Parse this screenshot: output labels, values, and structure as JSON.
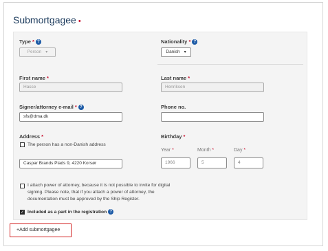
{
  "section": {
    "title": "Submortgagee",
    "required_marker": "•"
  },
  "type": {
    "label": "Type",
    "required": "*",
    "value": "Person"
  },
  "nationality": {
    "label": "Nationality",
    "required": "*",
    "value": "Danish"
  },
  "first_name": {
    "label": "First name",
    "required": "*",
    "value": "Hasse"
  },
  "last_name": {
    "label": "Last name",
    "required": "*",
    "value": "Henriksen"
  },
  "email": {
    "label": "Signer/attorney e-mail",
    "required": "*",
    "value": "sfs@dma.dk"
  },
  "phone": {
    "label": "Phone no.",
    "value": ""
  },
  "address": {
    "label": "Address",
    "required": "*",
    "non_danish_label": "The person has a non-Danish address",
    "value": "Caspar Brands Plads 9, 4220 Korsør"
  },
  "birthday": {
    "label": "Birthday",
    "required": "*",
    "year_label": "Year",
    "month_label": "Month",
    "day_label": "Day",
    "year": "1966",
    "month": "5",
    "day": "4"
  },
  "power_of_attorney": {
    "line1": "I attach power of attorney, because it is not possible to invite for digital",
    "line2": "signing. Please note, that if you attach a power of attorney, the",
    "line3": "documentation must be approved by the Ship Register."
  },
  "included": {
    "label": "Included as a part in the registration"
  },
  "add_button": {
    "label": "+Add submortgagee"
  },
  "icons": {
    "help": "?",
    "check": "✓",
    "caret": "▾"
  },
  "colors": {
    "accent": "#1c5aa6",
    "required": "#c8102e",
    "highlight_border": "#d21f1f"
  }
}
